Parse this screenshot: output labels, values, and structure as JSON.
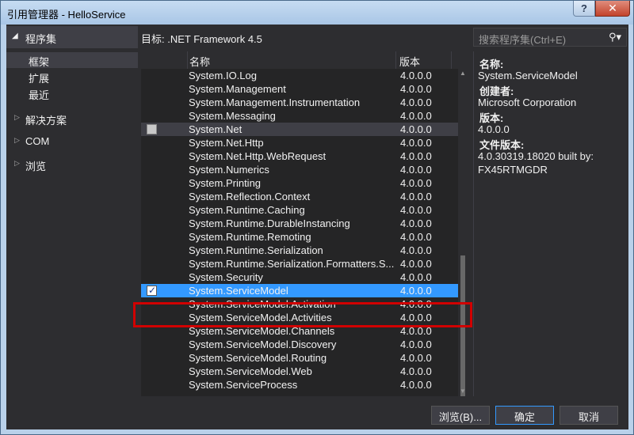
{
  "window": {
    "title": "引用管理器 - HelloService",
    "help_label": "?",
    "close_label": "✕"
  },
  "left": {
    "header": "程序集",
    "subitems": [
      {
        "label": "框架",
        "selected": true
      },
      {
        "label": "扩展",
        "selected": false
      },
      {
        "label": "最近",
        "selected": false
      }
    ],
    "categories": [
      "解决方案",
      "COM",
      "浏览"
    ]
  },
  "target_label": "目标: .NET Framework 4.5",
  "table": {
    "columns": {
      "name": "名称",
      "version": "版本"
    },
    "rows": [
      {
        "name": "System.IO.Log",
        "version": "4.0.0.0"
      },
      {
        "name": "System.Management",
        "version": "4.0.0.0"
      },
      {
        "name": "System.Management.Instrumentation",
        "version": "4.0.0.0"
      },
      {
        "name": "System.Messaging",
        "version": "4.0.0.0"
      },
      {
        "name": "System.Net",
        "version": "4.0.0.0",
        "state": "hover",
        "checkbox": "unchecked"
      },
      {
        "name": "System.Net.Http",
        "version": "4.0.0.0"
      },
      {
        "name": "System.Net.Http.WebRequest",
        "version": "4.0.0.0"
      },
      {
        "name": "System.Numerics",
        "version": "4.0.0.0"
      },
      {
        "name": "System.Printing",
        "version": "4.0.0.0"
      },
      {
        "name": "System.Reflection.Context",
        "version": "4.0.0.0"
      },
      {
        "name": "System.Runtime.Caching",
        "version": "4.0.0.0"
      },
      {
        "name": "System.Runtime.DurableInstancing",
        "version": "4.0.0.0"
      },
      {
        "name": "System.Runtime.Remoting",
        "version": "4.0.0.0"
      },
      {
        "name": "System.Runtime.Serialization",
        "version": "4.0.0.0"
      },
      {
        "name": "System.Runtime.Serialization.Formatters.S...",
        "version": "4.0.0.0"
      },
      {
        "name": "System.Security",
        "version": "4.0.0.0"
      },
      {
        "name": "System.ServiceModel",
        "version": "4.0.0.0",
        "state": "selected",
        "checkbox": "checked"
      },
      {
        "name": "System.ServiceModel.Activation",
        "version": "4.0.0.0"
      },
      {
        "name": "System.ServiceModel.Activities",
        "version": "4.0.0.0"
      },
      {
        "name": "System.ServiceModel.Channels",
        "version": "4.0.0.0"
      },
      {
        "name": "System.ServiceModel.Discovery",
        "version": "4.0.0.0"
      },
      {
        "name": "System.ServiceModel.Routing",
        "version": "4.0.0.0"
      },
      {
        "name": "System.ServiceModel.Web",
        "version": "4.0.0.0"
      },
      {
        "name": "System.ServiceProcess",
        "version": "4.0.0.0"
      }
    ]
  },
  "search": {
    "placeholder": "搜索程序集(Ctrl+E)",
    "icon": "search-icon"
  },
  "details": {
    "name_label": "名称:",
    "name_value": "System.ServiceModel",
    "creator_label": "创建者:",
    "creator_value": "Microsoft Corporation",
    "version_label": "版本:",
    "version_value": "4.0.0.0",
    "file_version_label": "文件版本:",
    "file_version_value_1": "4.0.30319.18020 built by:",
    "file_version_value_2": "FX45RTMGDR"
  },
  "footer": {
    "browse": "浏览(B)...",
    "ok": "确定",
    "cancel": "取消"
  },
  "colors": {
    "selection": "#3399ff",
    "highlight_box": "#d10000",
    "background": "#2d2d30"
  }
}
